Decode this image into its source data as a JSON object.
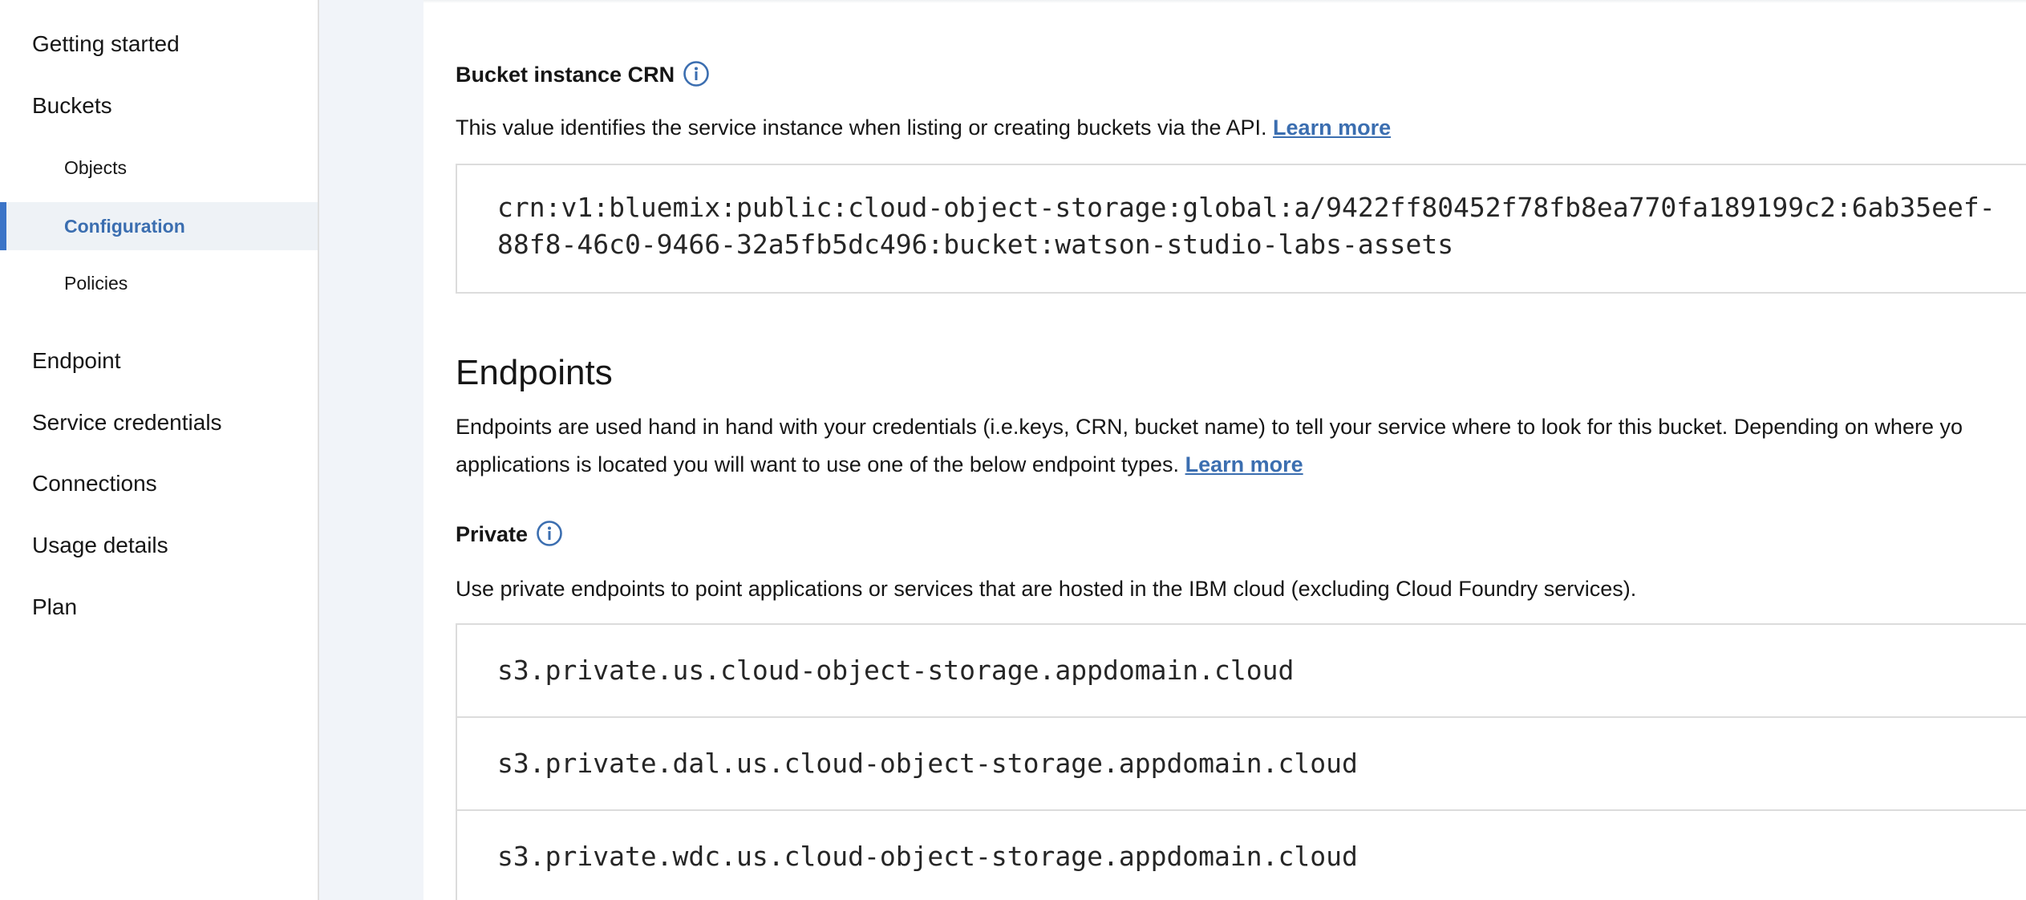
{
  "sidebar": {
    "items": [
      {
        "label": "Getting started"
      },
      {
        "label": "Buckets"
      },
      {
        "label": "Objects"
      },
      {
        "label": "Configuration"
      },
      {
        "label": "Policies"
      },
      {
        "label": "Endpoint"
      },
      {
        "label": "Service credentials"
      },
      {
        "label": "Connections"
      },
      {
        "label": "Usage details"
      },
      {
        "label": "Plan"
      }
    ],
    "active_item": "Configuration"
  },
  "crn": {
    "label": "Bucket instance CRN",
    "description": "This value identifies the service instance when listing or creating buckets via the API.",
    "learn_more": "Learn more",
    "value_line1": "crn:v1:bluemix:public:cloud-object-storage:global:a/9422ff80452f78fb8ea770fa189199c2:6ab35eef-",
    "value_line2": "88f8-46c0-9466-32a5fb5dc496:bucket:watson-studio-labs-assets"
  },
  "endpoints": {
    "title": "Endpoints",
    "description_line1": "Endpoints are used hand in hand with your credentials (i.e.keys, CRN, bucket name) to tell your service where to look for this bucket. Depending on where yo",
    "description_line2": "applications is located you will want to use one of the below endpoint types.",
    "learn_more": "Learn more",
    "private": {
      "label": "Private",
      "description": "Use private endpoints to point applications or services that are hosted in the IBM cloud (excluding Cloud Foundry services).",
      "items": [
        "s3.private.us.cloud-object-storage.appdomain.cloud",
        "s3.private.dal.us.cloud-object-storage.appdomain.cloud",
        "s3.private.wdc.us.cloud-object-storage.appdomain.cloud"
      ]
    }
  },
  "colors": {
    "accent": "#3b74c7",
    "link": "#3b6eb0",
    "active_bg": "#eef2f6",
    "gutter_bg": "#f1f4f9",
    "border": "#dcdcdc"
  },
  "icons": {
    "info": "info-circle-icon"
  }
}
